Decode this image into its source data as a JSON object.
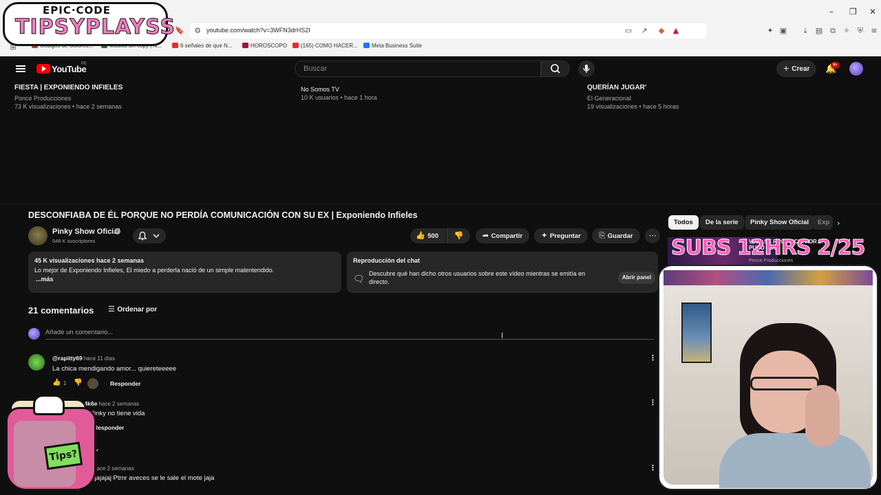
{
  "browser": {
    "url": "youtube.com/watch?v=3WFN3drHS2I",
    "bookmarks": [
      {
        "label": "Codigos de Colores...",
        "color": "#c0392b"
      },
      {
        "label": "Musica sin copy | N...",
        "color": "#555555"
      },
      {
        "label": "6 señales de que N...",
        "color": "#e52d27"
      },
      {
        "label": "HOROSCOPO",
        "color": "#a0153e"
      },
      {
        "label": "(165) COMO HACER...",
        "color": "#e52d27"
      },
      {
        "label": "Meta Business Suite",
        "color": "#1877f2"
      }
    ],
    "window_controls": [
      "–",
      "❐",
      "✕"
    ]
  },
  "overlay_logo": {
    "top_text": "EPIC·CODE",
    "main_text": "TIPSYPLAYSS"
  },
  "header": {
    "logo": "YouTube",
    "country": "PE",
    "search_placeholder": "Buscar",
    "create_label": "Crear",
    "notifications_badge": "9+"
  },
  "related_top": [
    {
      "title": "FIESTA | EXPONIENDO INFIELES",
      "channel": "Ponce Producciones",
      "meta": "73 K visualizaciones • hace 2 semanas"
    },
    {
      "title": "",
      "channel": "No Somos TV",
      "meta": "10 K usuarios • hace 1 hora"
    },
    {
      "title": "QUERÍAN JUGAR'",
      "channel": "El Generacional",
      "meta": "19 visualizaciones • hace 5 horas"
    }
  ],
  "video": {
    "title": "DESCONFIABA DE ÉL PORQUE NO PERDÍA COMUNICACIÓN CON SU EX | Exponiendo Infieles",
    "channel": "Pinky Show Oficial",
    "subscribers": "548 K suscriptores",
    "likes": "500",
    "share_label": "Compartir",
    "ask_label": "Preguntar",
    "save_label": "Guardar"
  },
  "description": {
    "stats": "45 K visualizaciones  hace 2 semanas",
    "text": "Lo mejor de Exponiendo Infieles, El miedo a perderla nació de un simple malentendido.",
    "more": "...más"
  },
  "chat_replay": {
    "title": "Reproducción del chat",
    "text": "Descubre qué han dicho otros usuarios sobre este vídeo mientras se emitía en directo.",
    "button": "Abrir panel"
  },
  "comments": {
    "count_label": "21 comentarios",
    "sort_label": "Ordenar por",
    "input_placeholder": "Añade un comentario...",
    "reply_label": "Responder",
    "items": [
      {
        "author": "@rapitty69",
        "time": "hace 11 días",
        "text": "La chica mendigando amor... quieretееееe",
        "likes": "1"
      },
      {
        "author": "@Francis-n4k6e",
        "time": "hace 2 semanas",
        "text": "e sin Pinky no tiene vida",
        "likes": ""
      },
      {
        "author": "",
        "time": "hace 2 semanas",
        "text": "IDO Jajajajaj Ptmr aveces se le sale el mote jaja",
        "likes": ""
      }
    ]
  },
  "sidebar": {
    "chips": [
      "Todos",
      "De la serie",
      "Pinky Show Oficial",
      "Exp"
    ],
    "top_video": {
      "banner_text": "SUBS 12HRS 2/25",
      "title": "VIN... SE PROVINCIA POR ... PUSO LOS",
      "channel": "Ponce Producciones"
    }
  },
  "mug_tag": "Tips?",
  "colors": {
    "yt_red": "#ff0000",
    "background": "#0f0f0f",
    "pill": "#272727",
    "brand_pink": "#f27ec2"
  }
}
